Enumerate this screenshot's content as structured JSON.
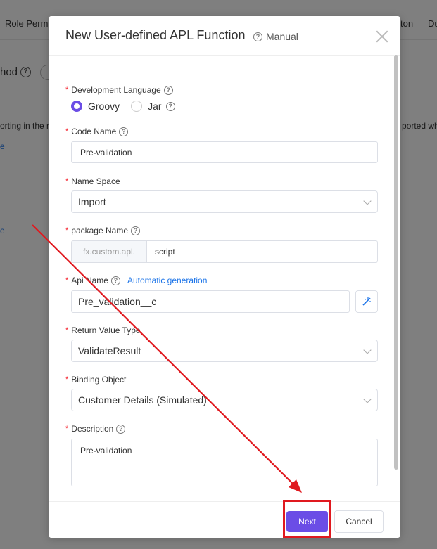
{
  "background": {
    "tabs": [
      "Role Perm",
      "ton",
      "Du"
    ],
    "method_label": "hod",
    "text_left": "orting in the m",
    "text_right": "ported wh",
    "link_1": "e",
    "link_2": "e"
  },
  "modal": {
    "title": "New User-defined APL Function",
    "manual_label": "Manual"
  },
  "form": {
    "dev_language": {
      "label": "Development Language",
      "options": [
        "Groovy",
        "Jar"
      ],
      "selected": "Groovy"
    },
    "code_name": {
      "label": "Code Name",
      "value": "Pre-validation"
    },
    "name_space": {
      "label": "Name Space",
      "value": "Import"
    },
    "package_name": {
      "label": "package Name",
      "prefix": "fx.custom.apl.",
      "value": "script"
    },
    "api_name": {
      "label": "Api Name",
      "auto_gen": "Automatic generation",
      "value": "Pre_validation__c"
    },
    "return_type": {
      "label": "Return Value Type",
      "value": "ValidateResult"
    },
    "binding_object": {
      "label": "Binding Object",
      "value": "Customer Details (Simulated)"
    },
    "description": {
      "label": "Description",
      "value": "Pre-validation"
    }
  },
  "footer": {
    "next_label": "Next",
    "cancel_label": "Cancel"
  },
  "colors": {
    "accent": "#6b4de6",
    "annotation": "#e0191f",
    "link": "#1a73e8"
  }
}
